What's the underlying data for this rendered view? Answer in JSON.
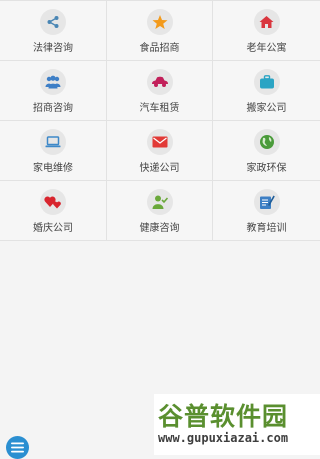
{
  "services": [
    {
      "label": "法律咨询",
      "icon": "share-icon",
      "color": "#4a86b4"
    },
    {
      "label": "食品招商",
      "icon": "star-icon",
      "color": "#f39a1b"
    },
    {
      "label": "老年公寓",
      "icon": "home-icon",
      "color": "#d9363e"
    },
    {
      "label": "招商咨询",
      "icon": "people-icon",
      "color": "#3e7fc6"
    },
    {
      "label": "汽车租赁",
      "icon": "car-icon",
      "color": "#c2205a"
    },
    {
      "label": "搬家公司",
      "icon": "briefcase-icon",
      "color": "#2aa4c4"
    },
    {
      "label": "家电维修",
      "icon": "laptop-icon",
      "color": "#3d88c8"
    },
    {
      "label": "快递公司",
      "icon": "envelope-icon",
      "color": "#e23a37"
    },
    {
      "label": "家政环保",
      "icon": "globe-icon",
      "color": "#4a9b3a"
    },
    {
      "label": "婚庆公司",
      "icon": "hearts-icon",
      "color": "#d8252e"
    },
    {
      "label": "健康咨询",
      "icon": "user-icon",
      "color": "#6aa83a"
    },
    {
      "label": "教育培训",
      "icon": "edit-icon",
      "color": "#3d7fc4"
    }
  ],
  "menu_button": {
    "icon": "menu-icon",
    "color": "#2b8fd1"
  },
  "watermark": {
    "main": "谷普软件园",
    "url": "www.gupuxiazai.com"
  }
}
